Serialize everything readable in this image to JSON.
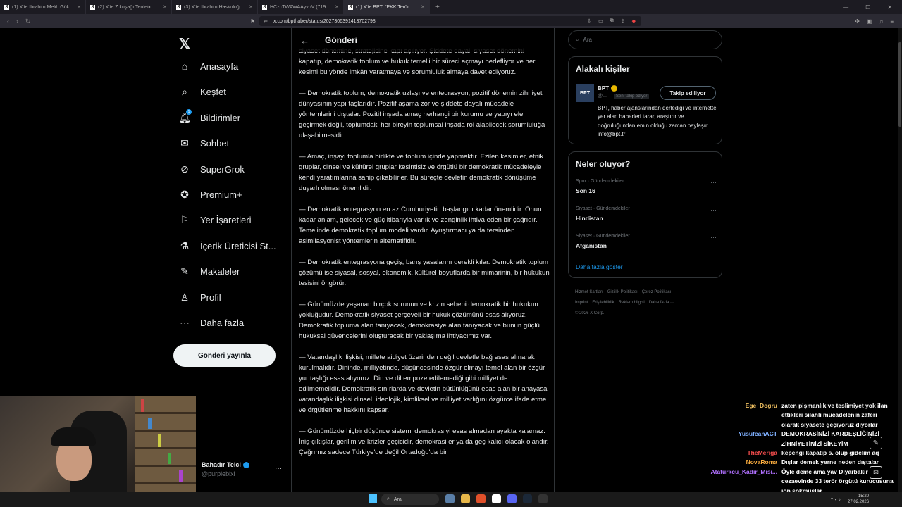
{
  "browser": {
    "tabs": [
      {
        "title": "(1) X'te İbrahim Melih Gökçek: \"SİZİN",
        "active": false
      },
      {
        "title": "(2) X'te Z kuşağı Tenfeix: \"tergeryen ta",
        "active": false
      },
      {
        "title": "(3) X'te İbrahim Haskoloğlu: \"#SO",
        "active": false
      },
      {
        "title": "HCzcTWAWAAyvbV (719×720)",
        "active": false
      },
      {
        "title": "(1) X'te BPT: \"PKK Terör Örgütü",
        "active": true
      }
    ],
    "url": "x.com/bpthaber/status/2027306391413702798"
  },
  "sidebar": {
    "items": [
      {
        "label": "Anasayfa",
        "icon": "home-icon"
      },
      {
        "label": "Keşfet",
        "icon": "search-icon"
      },
      {
        "label": "Bildirimler",
        "icon": "bell-icon",
        "badge": "1"
      },
      {
        "label": "Sohbet",
        "icon": "mail-icon"
      },
      {
        "label": "SuperGrok",
        "icon": "grok-icon"
      },
      {
        "label": "Premium+",
        "icon": "premium-icon"
      },
      {
        "label": "Yer İşaretleri",
        "icon": "bookmark-icon"
      },
      {
        "label": "İçerik Üreticisi St...",
        "icon": "flask-icon"
      },
      {
        "label": "Makaleler",
        "icon": "article-icon"
      },
      {
        "label": "Profil",
        "icon": "person-icon"
      },
      {
        "label": "Daha fazla",
        "icon": "more-circle-icon"
      }
    ],
    "post_button": "Gönderi yayınla",
    "user": {
      "name": "Bahadır Telci",
      "handle": "@purplebixi"
    }
  },
  "main": {
    "title": "Gönderi",
    "paragraphs": [
      "siyaset dönemine, stratejisine kapı açılıyor. Şiddete dayalı siyaset dönemini kapatıp, demokratik toplum ve hukuk temelli bir süreci açmayı hedefliyor ve her kesimi bu yönde imkân yaratmaya ve sorumluluk almaya davet ediyoruz.",
      "— Demokratik toplum, demokratik uzlaşı ve entegrasyon, pozitif dönemin zihniyet dünyasının yapı taşlarıdır. Pozitif aşama zor ve şiddete dayalı mücadele yöntemlerini dıştalar. Pozitif inşada amaç herhangi bir kurumu ve yapıyı ele geçirmek değil, toplumdaki her bireyin toplumsal inşada rol alabilecek sorumluluğa ulaşabilmesidir.",
      "— Amaç, inşayı toplumla birlikte ve toplum içinde yapmaktır. Ezilen kesimler, etnik gruplar, dinsel ve kültürel gruplar kesintisiz ve örgütlü bir demokratik mücadeleyle kendi yaratımlarına sahip çıkabilirler. Bu süreçte devletin demokratik dönüşüme duyarlı olması önemlidir.",
      "— Demokratik entegrasyon en az Cumhuriyetin başlangıcı kadar önemlidir. Onun kadar anlam, gelecek ve güç itibarıyla varlık ve zenginlik ihtiva eden bir çağrıdır. Temelinde demokratik toplum modeli vardır. Ayrıştırmacı ya da tersinden asimilasyonist yöntemlerin alternatifidir.",
      "— Demokratik entegrasyona geçiş, barış yasalarını gerekli kılar. Demokratik toplum çözümü ise siyasal, sosyal, ekonomik, kültürel boyutlarda bir mimarinin, bir hukukun tesisini öngörür.",
      "— Günümüzde yaşanan birçok sorunun ve krizin sebebi demokratik bir hukukun yokluğudur. Demokratik siyaset çerçeveli bir hukuk çözümünü esas alıyoruz. Demokratik topluma alan tanıyacak, demokrasiye alan tanıyacak ve bunun güçlü hukuksal güvencelerini oluşturacak bir yaklaşıma ihtiyacımız var.",
      "— Vatandaşlık ilişkisi, millete aidiyet üzerinden değil devletle bağ esas alınarak kurulmalıdır. Dininde, milliyetinde, düşüncesinde özgür olmayı temel alan bir özgür yurttaşlığı esas alıyoruz. Din ve dil empoze edilemediği gibi milliyet de edilmemelidir. Demokratik sınırlarda ve devletin bütünlüğünü esas alan bir anayasal vatandaşlık ilişkisi dinsel, ideolojik, kimliksel ve milliyet varlığını özgürce ifade etme ve örgütlenme hakkını kapsar.",
      "— Günümüzde hiçbir düşünce sistemi demokrasiyi esas almadan ayakta kalamaz. İniş-çıkışlar, gerilim ve krizler geçicidir, demokrasi er ya da geç kalıcı olacak olandır. Çağrımız sadece Türkiye'de değil Ortadoğu'da bir"
    ]
  },
  "right": {
    "search_placeholder": "Ara",
    "related_title": "Alakalı kişiler",
    "related": {
      "name": "BPT",
      "handle": "@...",
      "follows_you": "Seni takip ediyor",
      "follow_button": "Takip ediliyor",
      "bio": "BPT, haber ajanslarından derlediği ve internette yer alan haberleri tarar, araştırır ve doğruluğundan emin olduğu zaman paylaşır. info@bpt.tr",
      "logo_text": "BPT"
    },
    "trends_title": "Neler oluyor?",
    "trends": [
      {
        "category": "Spor · Gündemdekiler",
        "name": "Son 16"
      },
      {
        "category": "Siyaset · Gündemdekiler",
        "name": "Hindistan"
      },
      {
        "category": "Siyaset · Gündemdekiler",
        "name": "Afganistan"
      }
    ],
    "show_more": "Daha fazla göster",
    "footer_links": [
      "Hizmet Şartları",
      "Gizlilik Politikası",
      "Çerez Politikası",
      "Imprint",
      "Erişilebilirlik",
      "Reklam bilgisi",
      "Daha fazla ···"
    ],
    "copyright": "© 2026 X Corp."
  },
  "chat": [
    {
      "user": "Ege_Dogru",
      "color": "#f0c060",
      "text": "zaten pişmanlık ve teslimiyet yok ilan ettikleri silahlı mücadelenin zaferi olarak siyasete geçiyoruz diyorlar"
    },
    {
      "user": "YusufcanACT",
      "color": "#7fb0ff",
      "text": "DEMOKRASİNİZİ KARDEŞLİĞİNİZİ ZİHNİYETİNİZİ SİKEYİM"
    },
    {
      "user": "TheMeriga",
      "color": "#ff5050",
      "text": "kepengi kapatıp s. olup gidelim aq"
    },
    {
      "user": "NovaRoma",
      "color": "#ffb040",
      "text": "Dışlar demek yerne neden dıştalar"
    },
    {
      "user": "Ataturkcu_Kadir_Misi...",
      "color": "#b070ff",
      "text": "Öyle deme ama yav Diyarbakır cezaevinde 33 terör örgütü kurucusuna jop sokmuşlar"
    }
  ],
  "taskbar": {
    "search_placeholder": "Ara",
    "time": "15:20",
    "date": "27.02.2026"
  }
}
